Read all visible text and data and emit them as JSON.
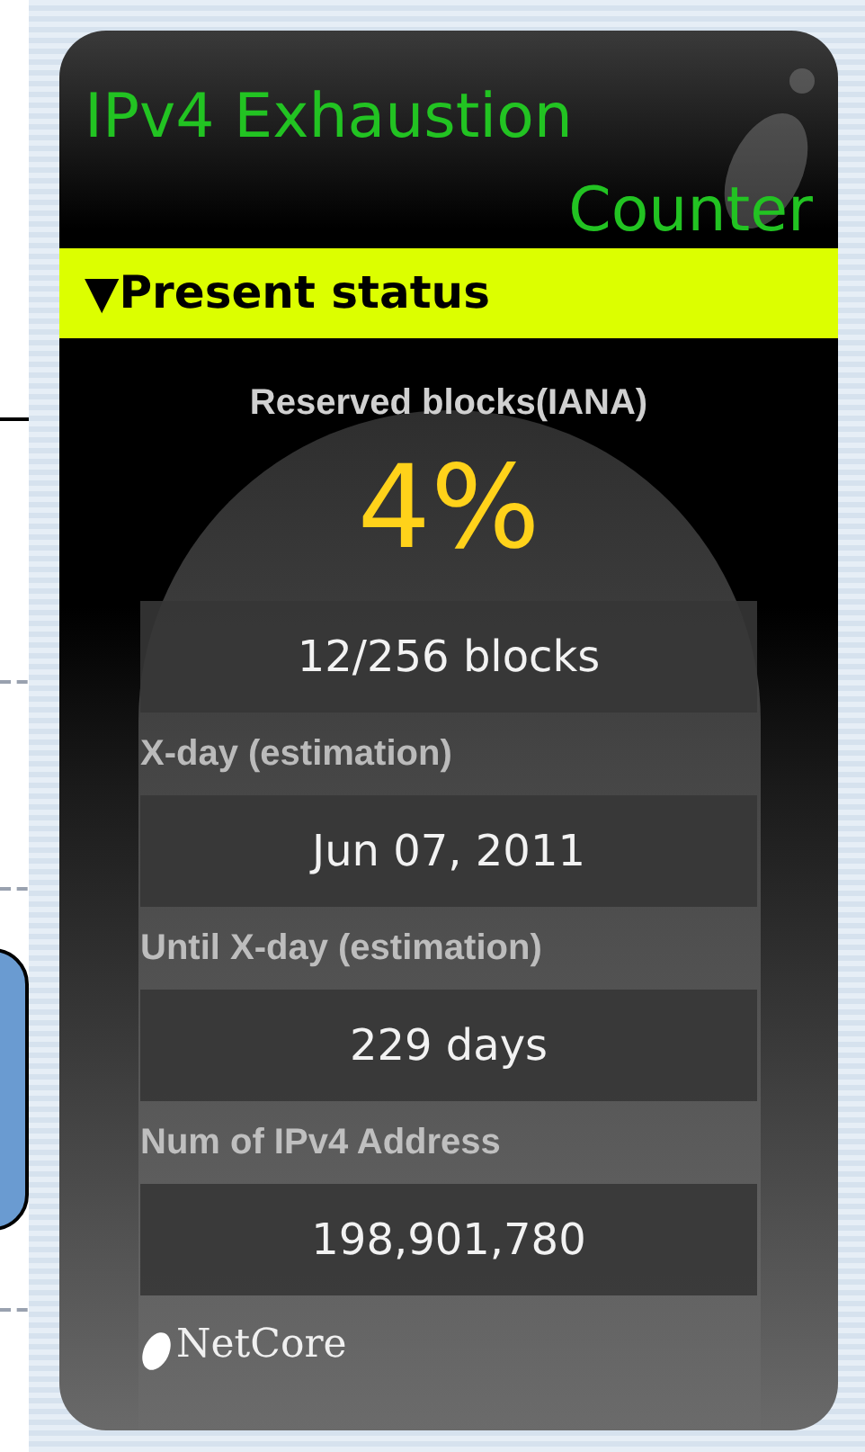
{
  "widget": {
    "title_line_1": "IPv4 Exhaustion",
    "title_line_2": "Counter",
    "section": "▼Present status",
    "headline": {
      "label": "Reserved blocks(IANA)",
      "percent": "4%"
    },
    "fields": [
      {
        "value": "12/256 blocks"
      },
      {
        "label": "X-day (estimation)",
        "value": "Jun 07, 2011"
      },
      {
        "label": "Until X-day (estimation)",
        "value": "229 days"
      },
      {
        "label": "Num of IPv4 Address",
        "value": "198,901,780"
      }
    ],
    "footer_logo": "NetCore"
  }
}
